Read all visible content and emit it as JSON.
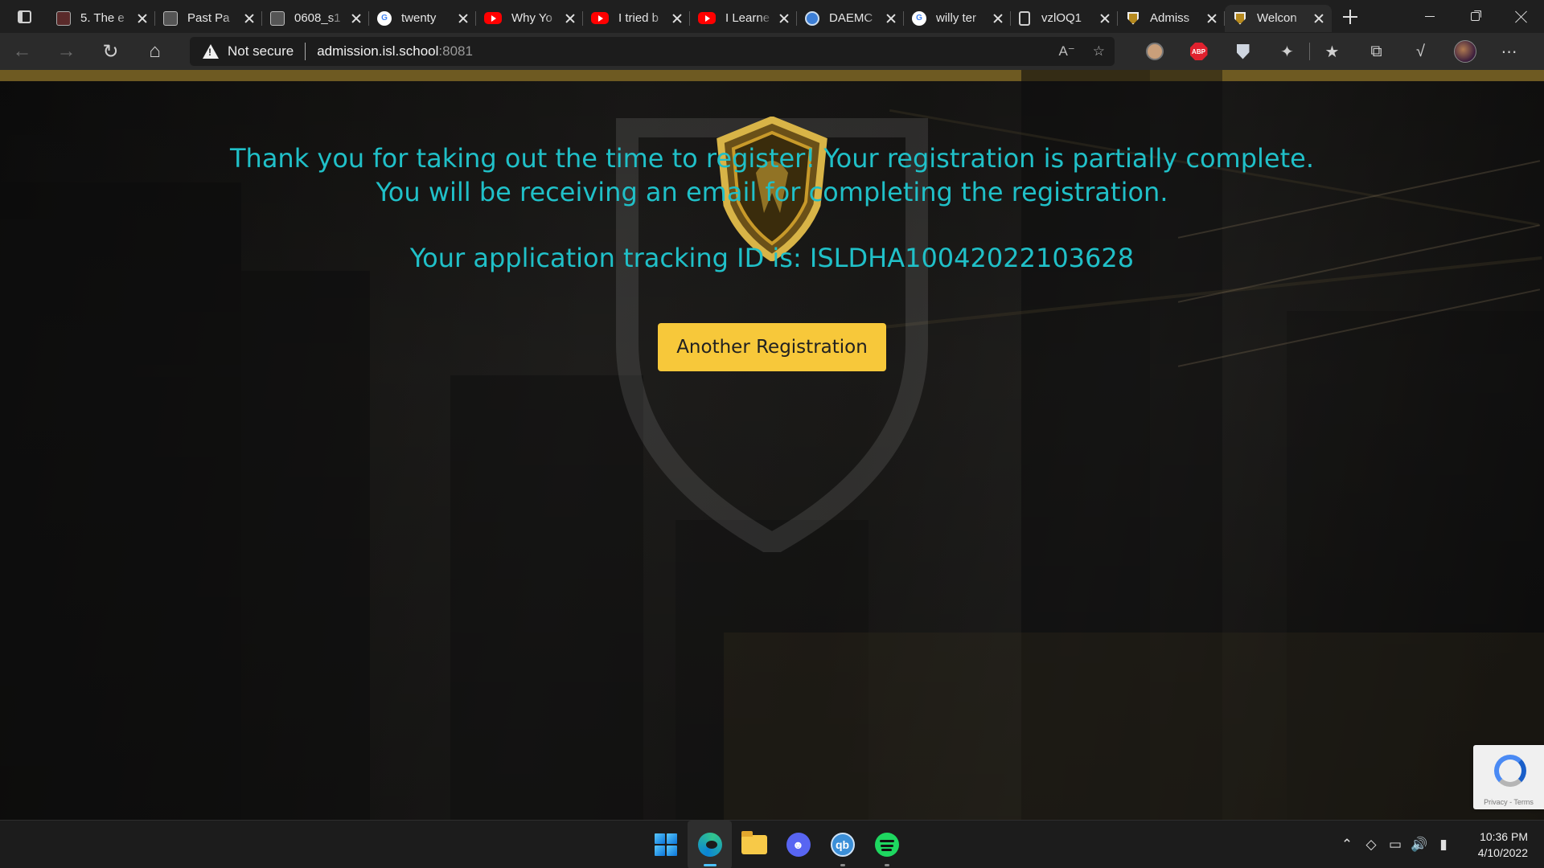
{
  "browser": {
    "tabs": [
      {
        "title": "5. The e",
        "icon": "pdf-icon",
        "active": false
      },
      {
        "title": "Past Pa",
        "icon": "document-icon",
        "active": false
      },
      {
        "title": "0608_s1",
        "icon": "document-icon",
        "active": false
      },
      {
        "title": "twenty",
        "icon": "google-icon",
        "active": false
      },
      {
        "title": "Why Yo",
        "icon": "youtube-icon",
        "active": false
      },
      {
        "title": "I tried b",
        "icon": "youtube-icon",
        "active": false
      },
      {
        "title": "I Learne",
        "icon": "youtube-icon",
        "active": false
      },
      {
        "title": "DAEMC",
        "icon": "daemon-icon",
        "active": false
      },
      {
        "title": "willy ter",
        "icon": "google-icon",
        "active": false
      },
      {
        "title": "vzlOQ1",
        "icon": "file-icon",
        "active": false
      },
      {
        "title": "Admiss",
        "icon": "school-shield-icon",
        "active": false
      },
      {
        "title": "Welcon",
        "icon": "school-shield-icon",
        "active": true
      }
    ],
    "address_bar": {
      "security_label": "Not secure",
      "host": "admission.isl.school",
      "port": ":8081"
    }
  },
  "page": {
    "message_line1": "Thank you for taking out the time to register! Your registration is partially complete.",
    "message_line2": "You will be receiving an email for completing the registration.",
    "tracking_text": "Your application tracking ID is: ISLDHA10042022103628",
    "button_label": "Another Registration",
    "recaptcha_terms": "Privacy - Terms"
  },
  "taskbar": {
    "apps": [
      "windows-start-icon",
      "edge-icon",
      "file-explorer-icon",
      "discord-icon",
      "qbittorrent-icon",
      "spotify-icon"
    ],
    "qb_label": "qb",
    "time": "10:36 PM",
    "date": "4/10/2022"
  },
  "colors": {
    "accent_text": "#20c0c8",
    "button_bg": "#f7c83a",
    "gold_strip": "#6e5a22"
  }
}
